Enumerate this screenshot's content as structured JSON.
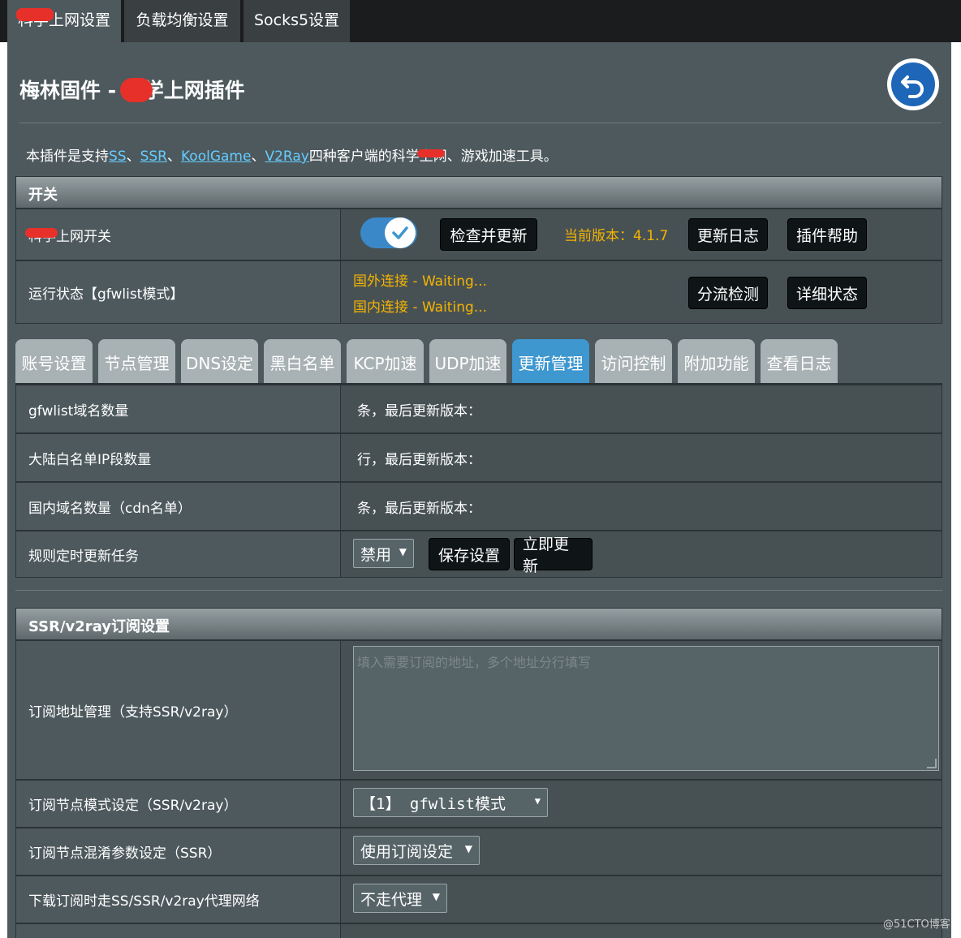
{
  "top_tabs": [
    {
      "label": "科学上网设置"
    },
    {
      "label": "负载均衡设置"
    },
    {
      "label": "Socks5设置"
    }
  ],
  "page_title": "梅林固件 - 科学上网插件",
  "intro": {
    "prefix": "本插件是支持",
    "links": [
      "SS",
      "SSR",
      "KoolGame",
      "V2Ray"
    ],
    "sep": "、",
    "suffix": "四种客户端的科学上网、游戏加速工具。"
  },
  "switch_section": {
    "header": "开关",
    "rows": {
      "proxy_switch": {
        "label": "科学上网开关",
        "check_update": "检查并更新",
        "version": "当前版本：4.1.7",
        "changelog": "更新日志",
        "help": "插件帮助"
      },
      "run_status": {
        "label": "运行状态【gfwlist模式】",
        "foreign": "国外连接 - Waiting...",
        "domestic": "国内连接 - Waiting...",
        "split_check": "分流检测",
        "detail_status": "详细状态"
      }
    }
  },
  "sub_tabs": [
    {
      "label": "账号设置"
    },
    {
      "label": "节点管理"
    },
    {
      "label": "DNS设定"
    },
    {
      "label": "黑白名单"
    },
    {
      "label": "KCP加速"
    },
    {
      "label": "UDP加速"
    },
    {
      "label": "更新管理",
      "active": true
    },
    {
      "label": "访问控制"
    },
    {
      "label": "附加功能"
    },
    {
      "label": "查看日志"
    }
  ],
  "update_rows": {
    "gfwlist": {
      "label": "gfwlist域名数量",
      "value": "条，最后更新版本："
    },
    "china_ip": {
      "label": "大陆白名单IP段数量",
      "value": "行，最后更新版本："
    },
    "cdn": {
      "label": "国内域名数量（cdn名单）",
      "value": "条，最后更新版本："
    },
    "schedule": {
      "label": "规则定时更新任务",
      "select_value": "禁用",
      "save": "保存设置",
      "update_now": "立即更新"
    }
  },
  "subscription": {
    "header": "SSR/v2ray订阅设置",
    "address": {
      "label": "订阅地址管理（支持SSR/v2ray）",
      "placeholder": "填入需要订阅的地址，多个地址分行填写"
    },
    "node_mode": {
      "label": "订阅节点模式设定（SSR/v2ray）",
      "value": "【1】 gfwlist模式"
    },
    "obfs": {
      "label": "订阅节点混淆参数设定（SSR）",
      "value": "使用订阅设定"
    },
    "download_proxy": {
      "label": "下载订阅时走SS/SSR/v2ray代理网络",
      "value": "不走代理"
    }
  },
  "watermark": "@51CTO博客",
  "colors": {
    "accent_blue": "#3e97cf",
    "version_yellow": "#f4b400",
    "link_cyan": "#66ccff",
    "redaction_red": "#e8302a"
  }
}
